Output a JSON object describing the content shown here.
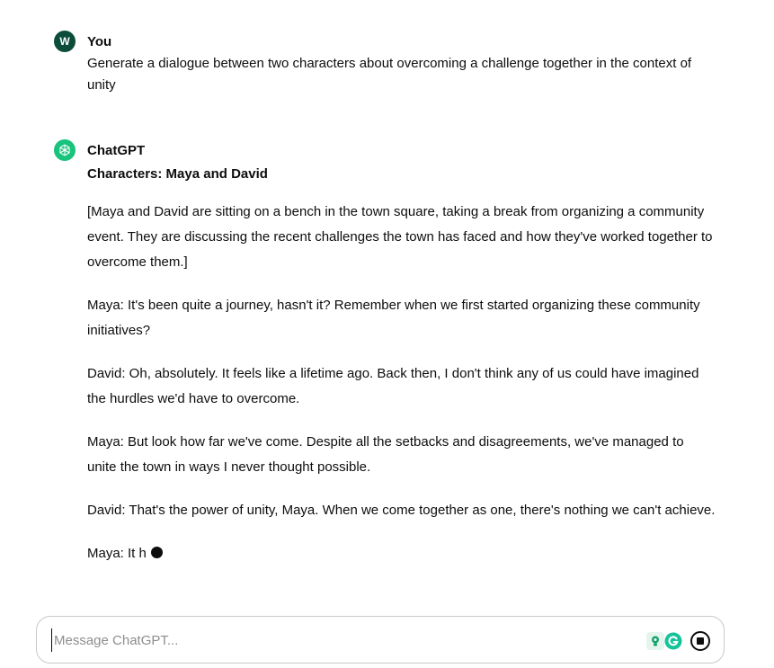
{
  "user_message": {
    "avatar_letter": "W",
    "author": "You",
    "text": "Generate a dialogue between two characters about overcoming a challenge together in the context of unity"
  },
  "assistant_message": {
    "author": "ChatGPT",
    "heading": "Characters: Maya and David",
    "paragraphs": [
      "[Maya and David are sitting on a bench in the town square, taking a break from organizing a community event. They are discussing the recent challenges the town has faced and how they've worked together to overcome them.]",
      "Maya: It's been quite a journey, hasn't it? Remember when we first started organizing these community initiatives?",
      "David: Oh, absolutely. It feels like a lifetime ago. Back then, I don't think any of us could have imagined the hurdles we'd have to overcome.",
      "Maya: But look how far we've come. Despite all the setbacks and disagreements, we've managed to unite the town in ways I never thought possible.",
      "David: That's the power of unity, Maya. When we come together as one, there's nothing we can't achieve.",
      "Maya: It h"
    ]
  },
  "composer": {
    "placeholder": "Message ChatGPT..."
  },
  "icons": {
    "assistant_avatar": "openai-logo-icon",
    "extension_1": "lightbulb-extension-icon",
    "extension_2": "grammarly-icon",
    "stop": "stop-generating-icon"
  },
  "colors": {
    "user_avatar": "#0b4d3a",
    "assistant_avatar": "#19c37d",
    "grammarly": "#15c39a"
  }
}
